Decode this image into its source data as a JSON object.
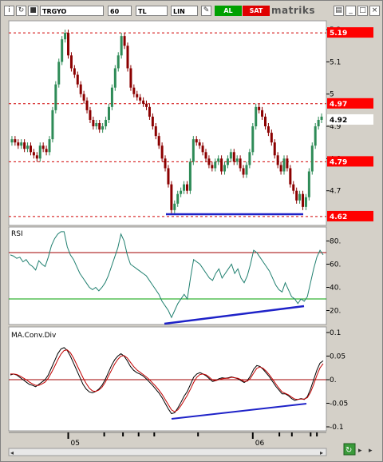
{
  "toolbar": {
    "symbol": "TRGYO",
    "interval": "60",
    "currency": "TL",
    "scale": "LIN",
    "buy_label": "AL",
    "sell_label": "SAT",
    "brand": "matriks",
    "icons": [
      "info-icon",
      "draw-icon",
      "print-icon",
      "minimize-icon",
      "maximize-icon",
      "close-icon"
    ]
  },
  "colors": {
    "candle_up": "#2e8b57",
    "candle_down": "#8b0000",
    "level_line": "#d00000",
    "price_label_bg": "#ff0000",
    "trend_line": "#1e22c8",
    "rsi_line": "#1f7f6f",
    "rsi_upper": "#a00000",
    "rsi_lower": "#00a000",
    "macd_line": "#000000",
    "signal_line": "#c00000",
    "zero_line": "#a00000"
  },
  "chart_data": [
    {
      "type": "candlestick",
      "title": "",
      "ylim": [
        4.6,
        5.22
      ],
      "yticks": [
        "5.2",
        "5.1",
        "5",
        "4.9",
        "4.8",
        "4.7"
      ],
      "price_labels": [
        "5.19",
        "4.97",
        "4.92",
        "4.79",
        "4.62"
      ],
      "levels": [
        5.19,
        4.97,
        4.79,
        4.62
      ],
      "last_price": 4.92,
      "x_labels": [
        "05",
        "06"
      ],
      "closes": [
        4.86,
        4.85,
        4.84,
        4.85,
        4.83,
        4.84,
        4.82,
        4.81,
        4.8,
        4.84,
        4.83,
        4.82,
        4.86,
        4.95,
        5.03,
        5.1,
        5.17,
        5.19,
        5.12,
        5.08,
        5.06,
        5.03,
        5.0,
        4.98,
        4.95,
        4.92,
        4.9,
        4.91,
        4.89,
        4.9,
        4.92,
        4.96,
        5.02,
        5.08,
        5.12,
        5.18,
        5.15,
        5.08,
        5.02,
        5.0,
        4.99,
        4.98,
        4.97,
        4.96,
        4.93,
        4.9,
        4.87,
        4.84,
        4.8,
        4.77,
        4.72,
        4.64,
        4.66,
        4.69,
        4.7,
        4.72,
        4.7,
        4.79,
        4.86,
        4.85,
        4.84,
        4.82,
        4.8,
        4.78,
        4.77,
        4.79,
        4.8,
        4.76,
        4.78,
        4.8,
        4.82,
        4.79,
        4.8,
        4.77,
        4.75,
        4.78,
        4.82,
        4.9,
        4.96,
        4.95,
        4.93,
        4.9,
        4.88,
        4.85,
        4.81,
        4.78,
        4.76,
        4.8,
        4.77,
        4.72,
        4.7,
        4.67,
        4.69,
        4.65,
        4.68,
        4.76,
        4.84,
        4.9,
        4.92,
        4.93
      ]
    },
    {
      "type": "line",
      "title": "RSI",
      "ylim": [
        10,
        90
      ],
      "yticks": [
        "80.",
        "60.",
        "40.",
        "20."
      ],
      "levels": [
        70,
        30
      ],
      "series": [
        {
          "values": [
            68,
            67,
            65,
            66,
            62,
            64,
            60,
            58,
            55,
            63,
            60,
            58,
            66,
            76,
            82,
            86,
            88,
            88,
            75,
            68,
            64,
            58,
            52,
            48,
            44,
            40,
            38,
            40,
            37,
            40,
            44,
            50,
            58,
            66,
            74,
            86,
            80,
            68,
            60,
            58,
            56,
            54,
            52,
            50,
            46,
            42,
            38,
            34,
            28,
            24,
            20,
            14,
            20,
            26,
            30,
            34,
            30,
            48,
            64,
            62,
            60,
            56,
            52,
            48,
            46,
            52,
            56,
            48,
            52,
            56,
            60,
            52,
            56,
            48,
            44,
            50,
            60,
            72,
            70,
            66,
            62,
            58,
            54,
            48,
            42,
            38,
            36,
            44,
            38,
            32,
            30,
            26,
            30,
            28,
            32,
            44,
            56,
            66,
            72,
            68
          ]
        }
      ]
    },
    {
      "type": "line",
      "title": "MA.Conv.Div",
      "ylim": [
        -0.1,
        0.1
      ],
      "yticks": [
        "0.1",
        "0.05",
        "0.",
        "-0.05",
        "-0.1"
      ],
      "series": [
        {
          "values": [
            0.01,
            0.012,
            0.01,
            0.005,
            0.0,
            -0.005,
            -0.01,
            -0.012,
            -0.015,
            -0.01,
            -0.005,
            0.0,
            0.01,
            0.025,
            0.04,
            0.055,
            0.065,
            0.068,
            0.062,
            0.05,
            0.035,
            0.02,
            0.005,
            -0.01,
            -0.02,
            -0.026,
            -0.028,
            -0.025,
            -0.02,
            -0.012,
            0.0,
            0.015,
            0.03,
            0.042,
            0.05,
            0.055,
            0.05,
            0.04,
            0.028,
            0.02,
            0.015,
            0.012,
            0.008,
            0.002,
            -0.005,
            -0.012,
            -0.02,
            -0.028,
            -0.038,
            -0.05,
            -0.062,
            -0.072,
            -0.07,
            -0.06,
            -0.048,
            -0.035,
            -0.025,
            -0.01,
            0.005,
            0.012,
            0.015,
            0.012,
            0.008,
            0.002,
            -0.004,
            -0.002,
            0.002,
            0.004,
            0.003,
            0.004,
            0.006,
            0.004,
            0.002,
            -0.002,
            -0.006,
            -0.002,
            0.008,
            0.022,
            0.03,
            0.028,
            0.022,
            0.014,
            0.006,
            -0.004,
            -0.014,
            -0.022,
            -0.03,
            -0.03,
            -0.034,
            -0.04,
            -0.044,
            -0.042,
            -0.04,
            -0.042,
            -0.036,
            -0.02,
            0.0,
            0.02,
            0.035,
            0.04
          ]
        },
        {
          "values": [
            0.012,
            0.012,
            0.011,
            0.008,
            0.004,
            0.0,
            -0.005,
            -0.009,
            -0.012,
            -0.012,
            -0.009,
            -0.005,
            0.003,
            0.015,
            0.028,
            0.042,
            0.054,
            0.062,
            0.063,
            0.057,
            0.046,
            0.032,
            0.018,
            0.004,
            -0.008,
            -0.018,
            -0.024,
            -0.025,
            -0.022,
            -0.016,
            -0.006,
            0.007,
            0.02,
            0.033,
            0.043,
            0.05,
            0.051,
            0.046,
            0.037,
            0.028,
            0.021,
            0.016,
            0.011,
            0.006,
            0.0,
            -0.007,
            -0.014,
            -0.022,
            -0.031,
            -0.042,
            -0.053,
            -0.064,
            -0.068,
            -0.064,
            -0.055,
            -0.044,
            -0.033,
            -0.02,
            -0.006,
            0.005,
            0.011,
            0.012,
            0.01,
            0.005,
            -0.001,
            -0.002,
            0.0,
            0.002,
            0.003,
            0.003,
            0.005,
            0.004,
            0.003,
            0.0,
            -0.004,
            -0.003,
            0.003,
            0.014,
            0.024,
            0.027,
            0.024,
            0.018,
            0.01,
            0.001,
            -0.009,
            -0.018,
            -0.026,
            -0.029,
            -0.032,
            -0.037,
            -0.041,
            -0.042,
            -0.041,
            -0.041,
            -0.038,
            -0.027,
            -0.01,
            0.009,
            0.025,
            0.034
          ]
        }
      ]
    }
  ]
}
